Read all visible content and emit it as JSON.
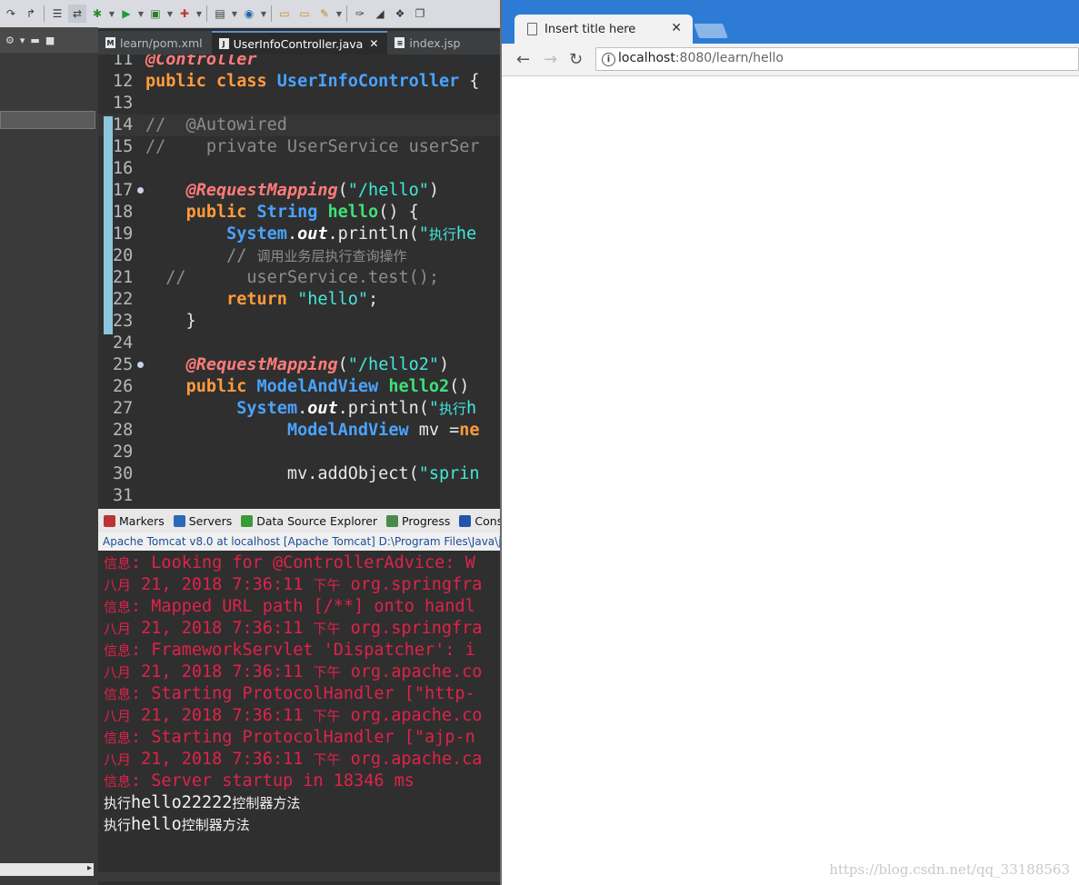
{
  "editor": {
    "tabs": [
      {
        "label": "learn/pom.xml",
        "icon": "M"
      },
      {
        "label": "UserInfoController.java",
        "icon": "J",
        "active": true
      },
      {
        "label": "index.jsp",
        "icon": "≡"
      }
    ],
    "lines": [
      {
        "n": "11",
        "segs": [
          [
            "an",
            "@Controller"
          ]
        ]
      },
      {
        "n": "12",
        "segs": [
          [
            "kw",
            "public class "
          ],
          [
            "ty",
            "UserInfoController"
          ],
          [
            "tx",
            " {"
          ]
        ]
      },
      {
        "n": "13",
        "segs": []
      },
      {
        "n": "14",
        "segs": [
          [
            "cm",
            "//  @Autowired"
          ]
        ],
        "hl": true
      },
      {
        "n": "15",
        "segs": [
          [
            "cm",
            "//    private UserService userSer"
          ]
        ]
      },
      {
        "n": "16",
        "segs": []
      },
      {
        "n": "17",
        "segs": [
          [
            "tx",
            "    "
          ],
          [
            "an",
            "@RequestMapping"
          ],
          [
            "tx",
            "("
          ],
          [
            "st",
            "\"/hello\""
          ],
          [
            "tx",
            ")"
          ]
        ],
        "fold": true
      },
      {
        "n": "18",
        "segs": [
          [
            "tx",
            "    "
          ],
          [
            "kw",
            "public "
          ],
          [
            "ty",
            "String "
          ],
          [
            "fn",
            "hello"
          ],
          [
            "tx",
            "() {"
          ]
        ]
      },
      {
        "n": "19",
        "segs": [
          [
            "tx",
            "        "
          ],
          [
            "ty",
            "System"
          ],
          [
            "tx",
            "."
          ],
          [
            "fd",
            "out"
          ],
          [
            "tx",
            ".println("
          ],
          [
            "st",
            "\"执行he"
          ]
        ]
      },
      {
        "n": "20",
        "segs": [
          [
            "cm",
            "        // 调用业务层执行查询操作"
          ]
        ]
      },
      {
        "n": "21",
        "segs": [
          [
            "cm",
            "  //      userService.test();"
          ]
        ]
      },
      {
        "n": "22",
        "segs": [
          [
            "tx",
            "        "
          ],
          [
            "kw",
            "return "
          ],
          [
            "st",
            "\"hello\""
          ],
          [
            "tx",
            ";"
          ]
        ]
      },
      {
        "n": "23",
        "segs": [
          [
            "tx",
            "    }"
          ]
        ]
      },
      {
        "n": "24",
        "segs": []
      },
      {
        "n": "25",
        "segs": [
          [
            "tx",
            "    "
          ],
          [
            "an",
            "@RequestMapping"
          ],
          [
            "tx",
            "("
          ],
          [
            "st",
            "\"/hello2\""
          ],
          [
            "tx",
            ")"
          ]
        ],
        "fold": true
      },
      {
        "n": "26",
        "segs": [
          [
            "tx",
            "    "
          ],
          [
            "kw",
            "public "
          ],
          [
            "ty",
            "ModelAndView "
          ],
          [
            "fn",
            "hello2"
          ],
          [
            "tx",
            "()"
          ]
        ]
      },
      {
        "n": "27",
        "segs": [
          [
            "tx",
            "         "
          ],
          [
            "ty",
            "System"
          ],
          [
            "tx",
            "."
          ],
          [
            "fd",
            "out"
          ],
          [
            "tx",
            ".println("
          ],
          [
            "st",
            "\"执行h"
          ]
        ]
      },
      {
        "n": "28",
        "segs": [
          [
            "tx",
            "              "
          ],
          [
            "ty",
            "ModelAndView "
          ],
          [
            "tx",
            "mv ="
          ],
          [
            "kw",
            "ne"
          ]
        ]
      },
      {
        "n": "29",
        "segs": []
      },
      {
        "n": "30",
        "segs": [
          [
            "tx",
            "              mv.addObject("
          ],
          [
            "st",
            "\"sprin"
          ]
        ]
      },
      {
        "n": "31",
        "segs": []
      }
    ]
  },
  "console": {
    "tabs": [
      "Markers",
      "Servers",
      "Data Source Explorer",
      "Progress",
      "Cons"
    ],
    "title": "Apache Tomcat v8.0  at localhost [Apache Tomcat] D:\\Program Files\\Java\\jd",
    "lines": [
      {
        "t": "信息: Looking for @ControllerAdvice: W"
      },
      {
        "t": "八月 21, 2018 7:36:11 下午 org.springfra"
      },
      {
        "t": "信息: Mapped URL path [/**] onto handl"
      },
      {
        "t": "八月 21, 2018 7:36:11 下午 org.springfra"
      },
      {
        "t": "信息: FrameworkServlet 'Dispatcher': i"
      },
      {
        "t": "八月 21, 2018 7:36:11 下午 org.apache.co"
      },
      {
        "t": "信息: Starting ProtocolHandler [\"http-"
      },
      {
        "t": "八月 21, 2018 7:36:11 下午 org.apache.co"
      },
      {
        "t": "信息: Starting ProtocolHandler [\"ajp-n"
      },
      {
        "t": "八月 21, 2018 7:36:11 下午 org.apache.ca"
      },
      {
        "t": "信息: Server startup in 18346 ms"
      },
      {
        "t": "执行hello22222控制器方法",
        "out": true
      },
      {
        "t": "执行hello控制器方法",
        "out": true
      }
    ]
  },
  "browser": {
    "tab_title": "Insert title here",
    "url_host": "localhost",
    "url_rest": ":8080/learn/hello",
    "watermark": "https://blog.csdn.net/qq_33188563"
  }
}
